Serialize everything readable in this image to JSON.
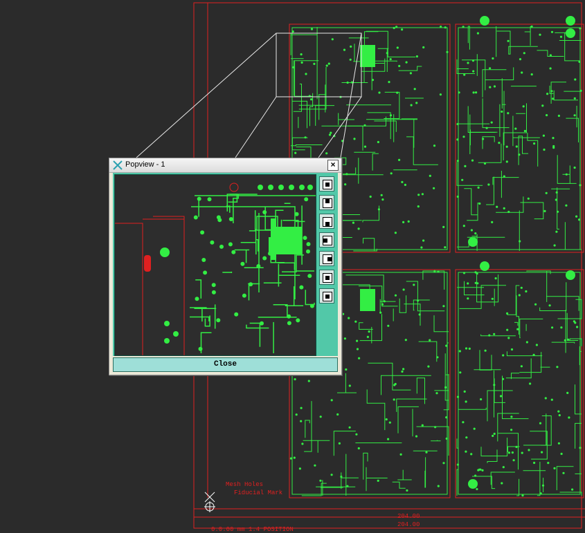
{
  "popview": {
    "title": "Popview - 1",
    "close_x": "×",
    "close_label": "Close",
    "tools": [
      {
        "icon": "fit-view-icon"
      },
      {
        "icon": "pan-up-icon"
      },
      {
        "icon": "pan-down-icon"
      },
      {
        "icon": "pan-left-icon"
      },
      {
        "icon": "pan-right-icon"
      },
      {
        "icon": "zoom-in-icon"
      },
      {
        "icon": "zoom-out-icon"
      }
    ]
  },
  "board": {
    "labels": {
      "note_1": "Mesh Holes",
      "note_2": "Fiducial Mark",
      "note_3": "204.00",
      "note_4": "204.00",
      "note_5": "0.0.00 mm 1.4 POSITION"
    }
  },
  "colors": {
    "background": "#2b2b2b",
    "copper_trace": "#33ee44",
    "outline": "#e02020",
    "popview_frame": "#52c8a8"
  }
}
